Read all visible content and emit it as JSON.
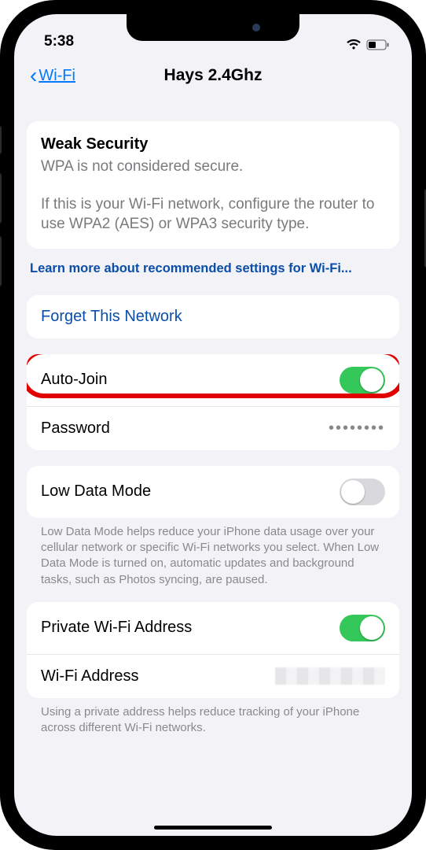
{
  "status": {
    "time": "5:38"
  },
  "nav": {
    "back_label": "Wi-Fi",
    "title": "Hays 2.4Ghz"
  },
  "security": {
    "heading": "Weak Security",
    "line1": "WPA is not considered secure.",
    "line2": "If this is your Wi-Fi network, configure the router to use WPA2 (AES) or WPA3 security type.",
    "learn_more": "Learn more about recommended settings for Wi-Fi..."
  },
  "forget": {
    "label": "Forget This Network"
  },
  "autojoin": {
    "label": "Auto-Join",
    "on": true
  },
  "password": {
    "label": "Password",
    "value": "••••••••"
  },
  "lowdata": {
    "label": "Low Data Mode",
    "on": false,
    "footer": "Low Data Mode helps reduce your iPhone data usage over your cellular network or specific Wi-Fi networks you select. When Low Data Mode is turned on, automatic updates and background tasks, such as Photos syncing, are paused."
  },
  "private": {
    "label": "Private Wi-Fi Address",
    "on": true
  },
  "wifiaddr": {
    "label": "Wi-Fi Address"
  },
  "private_footer": "Using a private address helps reduce tracking of your iPhone across different Wi-Fi networks."
}
